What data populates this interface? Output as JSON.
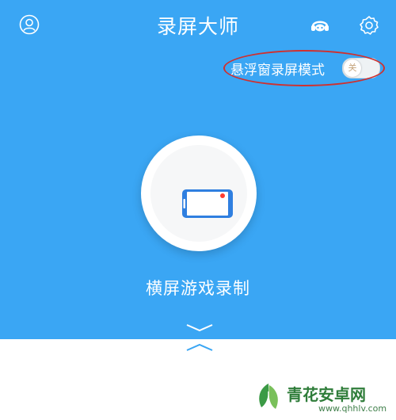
{
  "header": {
    "title": "录屏大师"
  },
  "float_mode": {
    "label": "悬浮窗录屏模式",
    "toggle_text": "关"
  },
  "record": {
    "label": "横屏游戏录制"
  },
  "watermark": {
    "name": "青花安卓网",
    "url": "www.qhhlv.com"
  },
  "colors": {
    "primary": "#3aa6f4",
    "highlight": "#d0302e",
    "phone_blue": "#2f7fe0",
    "record_dot": "#ff3b30"
  },
  "icons": {
    "user": "user-icon",
    "support": "headset-icon",
    "settings": "gear-icon",
    "record": "landscape-phone-icon"
  }
}
